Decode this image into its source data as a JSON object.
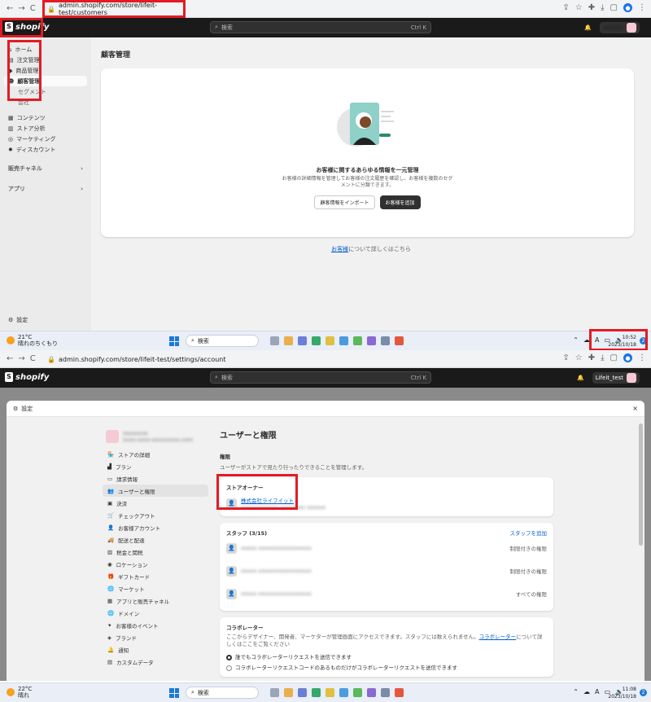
{
  "shot1": {
    "chrome": {
      "back": "←",
      "forward": "→",
      "reload": "C",
      "url": "admin.shopify.com/store/lifeit-test/customers"
    },
    "topbar": {
      "logo_text": "shopify",
      "search_placeholder": "検索",
      "search_shortcut": "Ctrl K"
    },
    "sidebar": {
      "items": [
        {
          "label": "ホーム"
        },
        {
          "label": "注文管理"
        },
        {
          "label": "商品管理"
        },
        {
          "label": "顧客管理"
        }
      ],
      "subitems": [
        "セグメント",
        "会社"
      ],
      "items2": [
        {
          "label": "コンテンツ"
        },
        {
          "label": "ストア分析"
        },
        {
          "label": "マーケティング"
        },
        {
          "label": "ディスカウント"
        }
      ],
      "sales_channels": "販売チャネル",
      "apps": "アプリ",
      "settings": "設定"
    },
    "main": {
      "title": "顧客管理",
      "empty_title": "お客様に関するあらゆる情報を一元管理",
      "empty_desc": "お客様の詳細情報を管理してお客様の注文履歴を確認し、お客様を複数のセグメントに分類できます。",
      "import_button": "顧客情報をインポート",
      "add_button": "お客様を追加",
      "learn_link": "お客様",
      "learn_rest": "について詳しくはこちら"
    },
    "taskbar": {
      "temp": "21°C",
      "weather": "晴れのちくもり",
      "search": "検索",
      "time": "10:52",
      "date": "2023/10/18",
      "notif": "2"
    }
  },
  "shot2": {
    "chrome": {
      "back": "←",
      "forward": "→",
      "reload": "C",
      "url": "admin.shopify.com/store/lifeit-test/settings/account"
    },
    "topbar": {
      "logo_text": "shopify",
      "search_placeholder": "検索",
      "search_shortcut": "Ctrl K",
      "store_name": "Lifeit_test"
    },
    "modal": {
      "title": "設定",
      "close": "×",
      "nav": [
        "ストアの詳細",
        "プラン",
        "請求情報",
        "ユーザーと権限",
        "決済",
        "チェックアウト",
        "お客様アカウント",
        "配送と配達",
        "税金と関税",
        "ロケーション",
        "ギフトカード",
        "マーケット",
        "アプリと販売チャネル",
        "ドメイン",
        "お客様のイベント",
        "ブランド",
        "通知",
        "カスタムデータ"
      ],
      "content": {
        "title": "ユーザーと権限",
        "perm_label": "権限",
        "perm_hint": "ユーザーがストアで見たり行ったりできることを管理します。",
        "owner_label": "ストアオーナー",
        "owner_name": "株式会社ライフイット",
        "staff_label": "スタッフ (3/15)",
        "add_staff": "スタッフを追加",
        "staff_perms": [
          "制限付きの権限",
          "制限付きの権限",
          "すべての権限"
        ],
        "collab_label": "コラボレーター",
        "collab_desc_a": "ここからデザイナー、開発者、マーケターが管理画面にアクセスできます。スタッフには数えられません。",
        "collab_link": "コラボレーター",
        "collab_desc_b": "について詳しくはここをご覧ください",
        "radio1": "誰でもコラボレーターリクエストを送信できます",
        "radio2": "コラボレーターリクエストコードのあるものだけがコラボレーターリクエストを送信できます"
      }
    },
    "taskbar": {
      "temp": "22°C",
      "weather": "晴れ",
      "search": "検索",
      "time": "11:08",
      "date": "2023/10/18",
      "notif": "2"
    }
  }
}
